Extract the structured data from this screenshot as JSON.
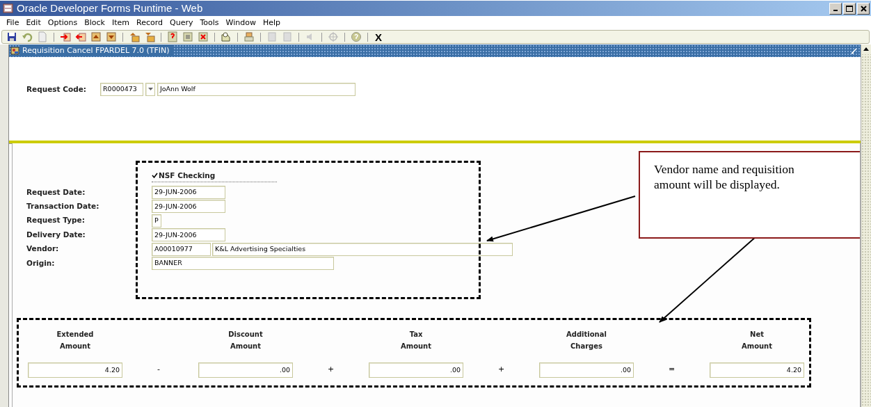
{
  "window": {
    "title": "Oracle Developer Forms Runtime - Web"
  },
  "menu": [
    {
      "label": "File"
    },
    {
      "label": "Edit"
    },
    {
      "label": "Options"
    },
    {
      "label": "Block"
    },
    {
      "label": "Item"
    },
    {
      "label": "Record"
    },
    {
      "label": "Query"
    },
    {
      "label": "Tools"
    },
    {
      "label": "Window"
    },
    {
      "label": "Help"
    }
  ],
  "toolbar": {
    "exit_label": "X"
  },
  "form": {
    "title": "Requisition Cancel  FPARDEL  7.0  (TFIN)",
    "request_code": {
      "label": "Request Code:",
      "code": "R0000473",
      "name": "JoAnn Wolf"
    },
    "nsf_checking": {
      "label": "NSF Checking",
      "checked": true
    },
    "fields": [
      {
        "label": "Request Date:",
        "values": [
          "29-JUN-2006"
        ],
        "kind": "date"
      },
      {
        "label": "Transaction Date:",
        "values": [
          "29-JUN-2006"
        ],
        "kind": "date"
      },
      {
        "label": "Request Type:",
        "values": [
          "P"
        ],
        "kind": "short"
      },
      {
        "label": "Delivery Date:",
        "values": [
          "29-JUN-2006"
        ],
        "kind": "date"
      },
      {
        "label": "Vendor:",
        "values": [
          "A00010977",
          "K&L Advertising Specialties"
        ],
        "kind": "vendor"
      },
      {
        "label": "Origin:",
        "values": [
          "BANNER"
        ],
        "kind": "wide"
      }
    ],
    "amounts": [
      {
        "label_lines": [
          "Extended",
          "Amount"
        ],
        "value": "4.20"
      },
      {
        "operator": "-",
        "label_lines": [
          "Discount",
          "Amount"
        ],
        "value": ".00"
      },
      {
        "operator": "+",
        "label_lines": [
          "Tax",
          "Amount"
        ],
        "value": ".00"
      },
      {
        "operator": "+",
        "label_lines": [
          "Additional",
          "Charges"
        ],
        "value": ".00"
      },
      {
        "operator": "=",
        "label_lines": [
          "Net",
          "Amount"
        ],
        "value": "4.20"
      }
    ]
  },
  "callout": {
    "text": "Vendor name and requisition amount will be displayed."
  }
}
